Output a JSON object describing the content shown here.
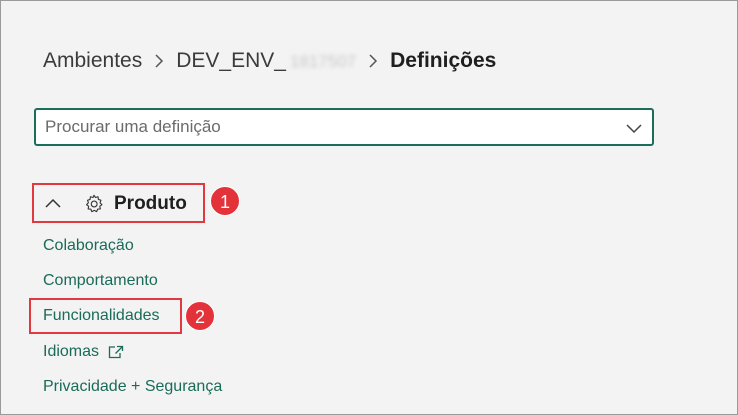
{
  "breadcrumb": {
    "items": [
      "Ambientes",
      "DEV_ENV_"
    ],
    "blurred_suffix": "1817507",
    "current": "Definições"
  },
  "search": {
    "placeholder": "Procurar uma definição",
    "value": ""
  },
  "section": {
    "title": "Produto",
    "expanded": true
  },
  "links": [
    {
      "label": "Colaboração",
      "external": false
    },
    {
      "label": "Comportamento",
      "external": false
    },
    {
      "label": "Funcionalidades",
      "external": false
    },
    {
      "label": "Idiomas",
      "external": true
    },
    {
      "label": "Privacidade + Segurança",
      "external": false
    }
  ],
  "annotations": {
    "badge_1": "1",
    "badge_2": "2"
  },
  "colors": {
    "accent": "#1b6e5c",
    "link": "#1a6b58",
    "annotation": "#e4323a"
  },
  "icons": [
    "chevron-right-icon",
    "chevron-down-icon",
    "chevron-up-icon",
    "gear-icon",
    "external-link-icon"
  ]
}
